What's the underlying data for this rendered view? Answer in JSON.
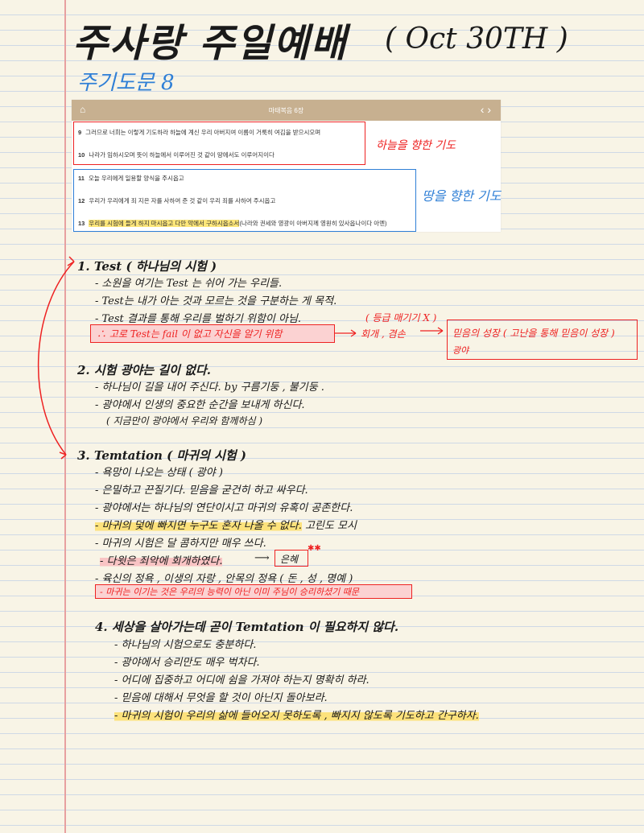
{
  "header": {
    "title": "주사랑 주일예배",
    "date": "( Oct  30TH )",
    "subtitle": "주기도문 8"
  },
  "screenshot": {
    "title": "마태복음 6장",
    "verses": [
      {
        "num": "9",
        "text": "그러므로 너희는 이렇게 기도하라 하늘에 계신 우리 아버지여 이름이 거룩히 여김을 받으시오며"
      },
      {
        "num": "10",
        "text": "나라가 임하시오며 뜻이 하늘에서 이루어진 것 같이 땅에서도 이루어지이다"
      },
      {
        "num": "11",
        "text": "오늘 우리에게 일용할 양식을 주시옵고"
      },
      {
        "num": "12",
        "text": "우리가 우리에게 죄 지은 자를 사하여 준 것 같이 우리 죄를 사하여 주시옵고"
      },
      {
        "num": "13",
        "text_highlight": "우리를 시험에 들게 하지 마시옵고 다만 악에서 구하시옵소서",
        "text_rest": "(나라와 권세와 영광이 아버지께 영원히 있사옵나이다 아멘)"
      }
    ],
    "note_red": "하늘을 향한 기도",
    "note_blue": "땅을 향한 기도"
  },
  "notes": {
    "s1": {
      "heading": "1.  Test  ( 하나님의 시험 )",
      "lines": [
        "- 소원을  여기는  Test 는  쉬어 가는  우리들.",
        "- Test는  내가  아는  것과  모르는  것을  구분하는 게  목적.",
        "- Test  결과를  통해  우리를  벌하기  위함이  아님."
      ],
      "note_red1": "( 등급 매기기  X )",
      "boxed": "∴ 고로  Test는  fail 이  없고  자신을  알기 위함",
      "arrow_text": "회개 , 겸손",
      "growth": "믿음의  성장  ( 고난을  통해  믿음이 성장 )",
      "growth2": "광야"
    },
    "s2": {
      "heading": "2.  시험  광야는  길이  없다.",
      "lines": [
        "- 하나님이   길을   내어  주신다.     by  구름기둥 , 불기둥 .",
        "- 광야에서  인생의  중요한  순간을  보내게  하신다.",
        "( 지금만이  광야에서  우리와  함께하심 )"
      ]
    },
    "s3": {
      "heading": "3.  Temtation  ( 마귀의  시험 )",
      "lines": [
        "- 욕망이  나오는  상태  ( 광야 )",
        "- 은밀하고  끈질기다.   믿음을  굳건히  하고  싸우다.",
        "- 광야에서는  하나님의  연단이시고  마귀의  유혹이  공존한다."
      ],
      "hl1": "- 마귀의  덫에  빠지면  누구도  혼자  나올 수  없다.",
      "hl1_rest": "  고린도 모시",
      "line5": "- 마귀의  시험은  달 콤하지만  매우  쓰다.",
      "pk1": "- 다윗은  죄악에  회개하였다.",
      "arrow_word": "은혜",
      "line7": "- 육신의  정욕 ,  이생의  자랑 ,  안목의  정욕      ( 돈 , 성 , 명예 )",
      "pk2": "- 마귀는  이기는  것은  우리의  능력이  아닌  이미  주님이  승리하셨기  때문"
    },
    "s4": {
      "heading": "4.  세상을  살아가는데  곧이  Temtation 이  필요하지  않다.",
      "lines": [
        "- 하나님의  시험으로도  충분하다.",
        "- 광야에서  승리만도   매우  벅차다.",
        "- 어디에  집중하고   어디에  쉼을  가져야 하는지  명확히  하라.",
        "- 믿음에  대해서  무엇을 할 것이 아닌지  돌아보라."
      ],
      "hl": "- 마귀의  시험이  우리의  삶에  들어오지  못하도록 ,  빠지지  않도록   기도하고   간구하자."
    }
  },
  "colors": {
    "red": "#e22222",
    "blue": "#2f7fd6",
    "highlight": "#fde27c",
    "pink": "#f9c4c4",
    "bar": "#c7b090"
  }
}
